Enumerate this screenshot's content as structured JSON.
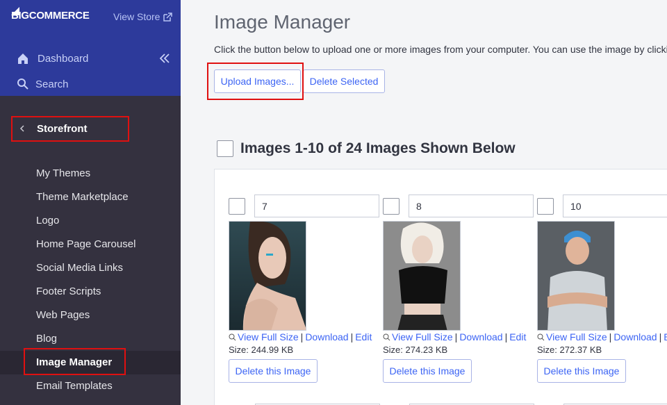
{
  "brand": {
    "logo_text_big": "BIG",
    "logo_text_rest": "COMMERCE",
    "view_store": "View Store"
  },
  "nav": {
    "dashboard": "Dashboard",
    "search": "Search"
  },
  "storefront": {
    "label": "Storefront"
  },
  "menu": [
    {
      "label": "My Themes"
    },
    {
      "label": "Theme Marketplace"
    },
    {
      "label": "Logo"
    },
    {
      "label": "Home Page Carousel"
    },
    {
      "label": "Social Media Links"
    },
    {
      "label": "Footer Scripts"
    },
    {
      "label": "Web Pages"
    },
    {
      "label": "Blog"
    },
    {
      "label": "Image Manager",
      "active": true
    },
    {
      "label": "Email Templates"
    }
  ],
  "main": {
    "title": "Image Manager",
    "intro": "Click the button below to upload one or more images from your computer. You can use the image by clicking",
    "upload_button": "Upload Images...",
    "delete_selected_button": "Delete Selected",
    "section_title": "Images 1-10 of 24 Images Shown Below"
  },
  "images": [
    {
      "name": "7",
      "size": "Size: 244.99 KB"
    },
    {
      "name": "8",
      "size": "Size: 274.23 KB"
    },
    {
      "name": "10",
      "size": "Size: 272.37 KB"
    }
  ],
  "image_actions": {
    "view": "View Full Size",
    "download": "Download",
    "edit": "Edit",
    "delete": "Delete this Image"
  },
  "colors": {
    "sidebar_top": "#2d3a9b",
    "sidebar": "#34313f",
    "link": "#3c64f4",
    "highlight": "#e01010"
  }
}
